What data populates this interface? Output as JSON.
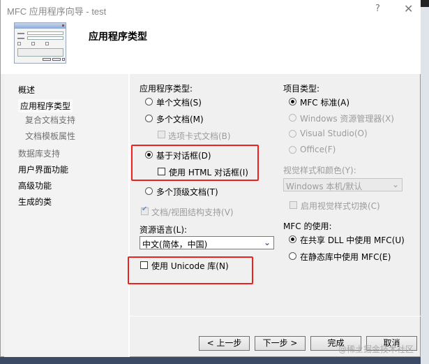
{
  "window": {
    "title": "MFC 应用程序向导 - test",
    "help_label": "?",
    "close_label": "✕"
  },
  "header": {
    "title": "应用程序类型"
  },
  "nav": {
    "items": [
      {
        "label": "概述",
        "state": "normal"
      },
      {
        "label": "应用程序类型",
        "state": "selected"
      },
      {
        "label": "复合文档支持",
        "state": "disabled"
      },
      {
        "label": "文档模板属性",
        "state": "disabled"
      },
      {
        "label": "数据库支持",
        "state": "disabled"
      },
      {
        "label": "用户界面功能",
        "state": "normal"
      },
      {
        "label": "高级功能",
        "state": "normal"
      },
      {
        "label": "生成的类",
        "state": "normal"
      }
    ]
  },
  "app_type": {
    "label": "应用程序类型:",
    "options": [
      {
        "label": "单个文档(S)",
        "checked": false,
        "enabled": true
      },
      {
        "label": "多个文档(M)",
        "checked": false,
        "enabled": true
      },
      {
        "label": "基于对话框(D)",
        "checked": true,
        "enabled": true
      },
      {
        "label": "多个顶级文档(T)",
        "checked": false,
        "enabled": true
      }
    ],
    "tabbed_docs": {
      "label": "选项卡式文档(B)",
      "checked": false,
      "enabled": false
    },
    "html_dialog": {
      "label": "使用 HTML 对话框(I)",
      "checked": false,
      "enabled": true
    },
    "doc_view": {
      "label": "文档/视图结构支持(V)",
      "checked": true,
      "enabled": false
    }
  },
  "resource_lang": {
    "label": "资源语言(L):",
    "value": "中文(简体，中国)"
  },
  "unicode": {
    "label": "使用 Unicode 库(N)",
    "checked": false
  },
  "project_type": {
    "label": "项目类型:",
    "options": [
      {
        "label": "MFC 标准(A)",
        "checked": true,
        "enabled": true
      },
      {
        "label": "Windows 资源管理器(X)",
        "checked": false,
        "enabled": false
      },
      {
        "label": "Visual Studio(O)",
        "checked": false,
        "enabled": false
      },
      {
        "label": "Office(F)",
        "checked": false,
        "enabled": false
      }
    ]
  },
  "visual_style": {
    "label": "视觉样式和颜色(Y):",
    "value": "Windows 本机/默认",
    "toggle": {
      "label": "启用视觉样式切换(C)",
      "checked": false,
      "enabled": false
    }
  },
  "mfc_use": {
    "label": "MFC 的使用:",
    "options": [
      {
        "label": "在共享 DLL 中使用 MFC(U)",
        "checked": true
      },
      {
        "label": "在静态库中使用 MFC(E)",
        "checked": false
      }
    ]
  },
  "buttons": {
    "back": "< 上一步",
    "next": "下一步 >",
    "finish": "完成",
    "cancel": "取消"
  },
  "watermark": "@稀土掘金技术社区",
  "colors": {
    "highlight_box": "#f21f1f"
  }
}
